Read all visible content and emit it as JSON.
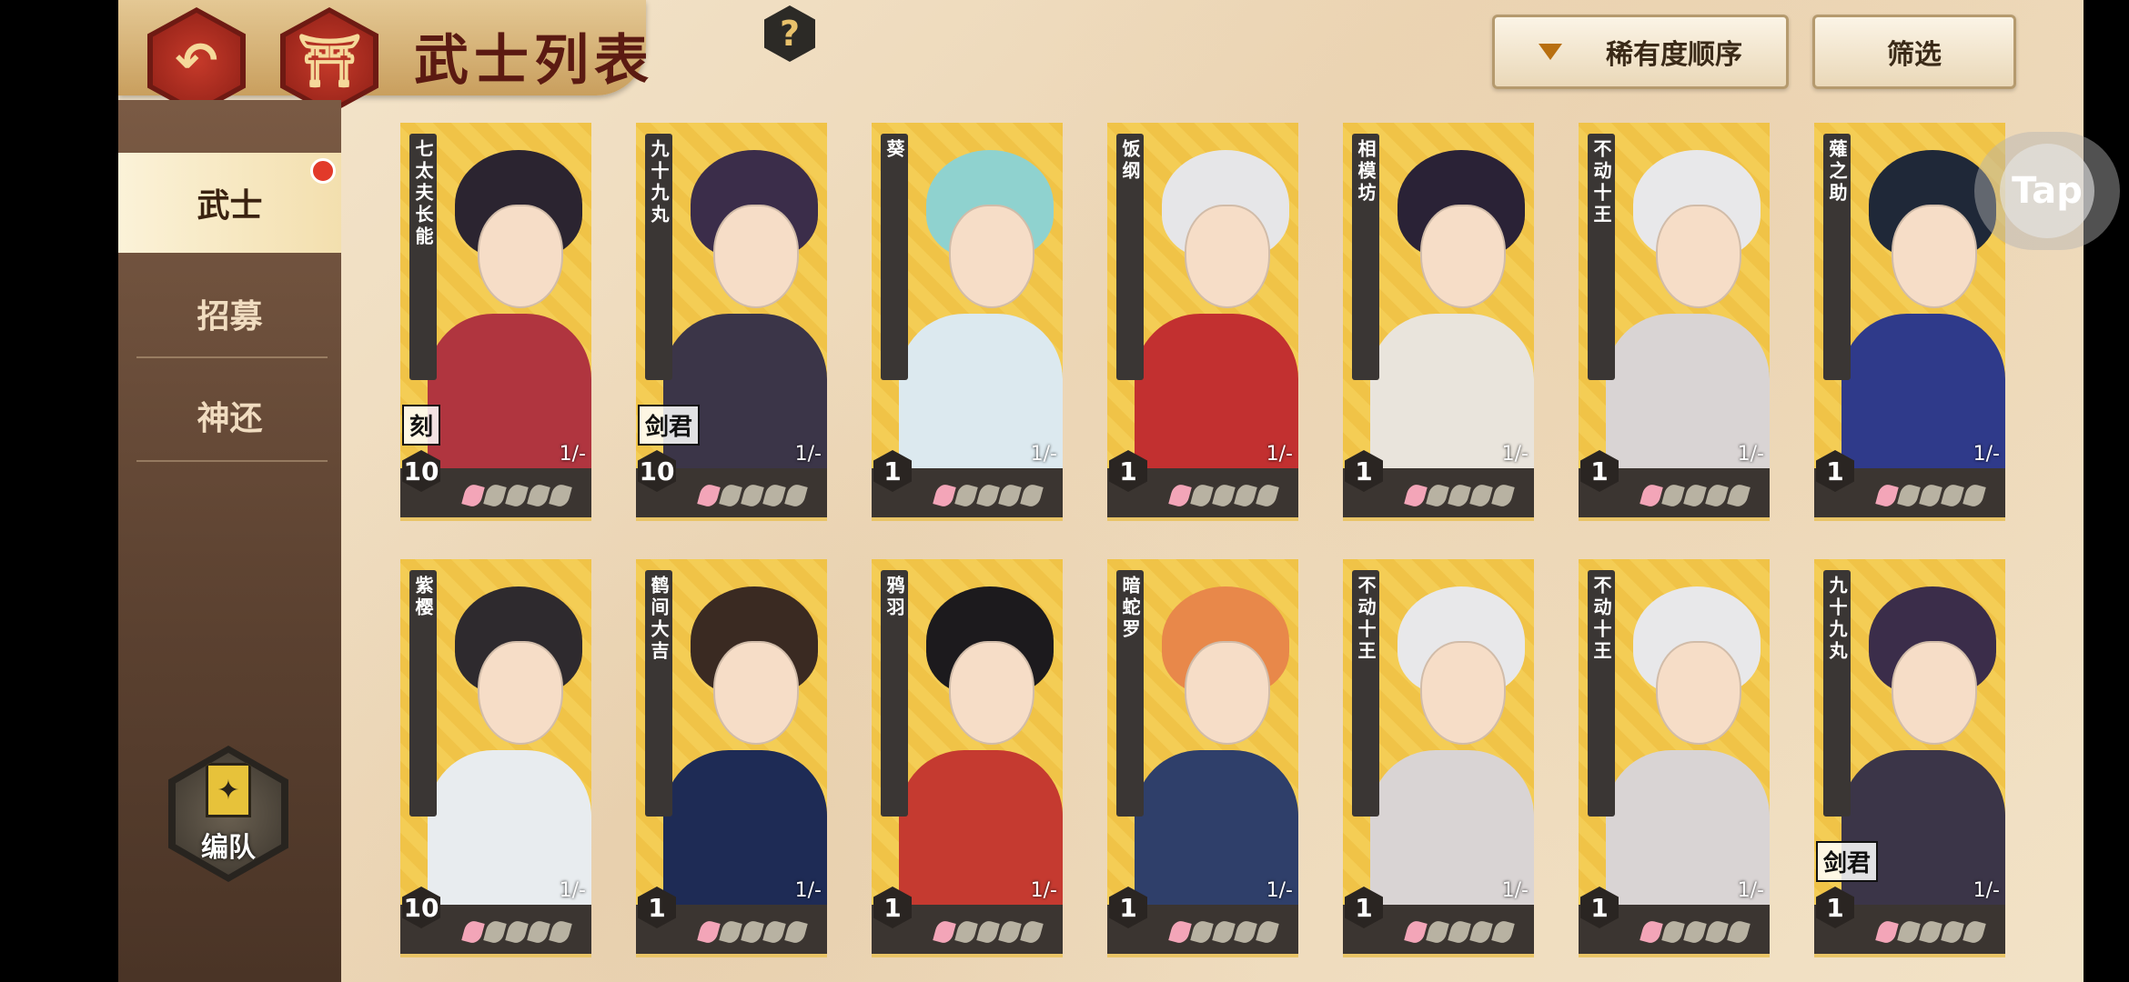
{
  "header": {
    "title": "武士列表",
    "help_label": "?",
    "sort_label": "稀有度顺序",
    "filter_label": "筛选",
    "back_glyph": "↶",
    "home_glyph": "⛩"
  },
  "sidebar": {
    "items": [
      {
        "label": "武士",
        "active": true,
        "badge": true
      },
      {
        "label": "招募",
        "active": false
      },
      {
        "label": "神还",
        "active": false
      }
    ],
    "team_label": "编队"
  },
  "overlay": {
    "tap_label": "Tap"
  },
  "cards": [
    {
      "name": "七太夫长能",
      "level": "10",
      "count": "1/-",
      "seal": "刻",
      "petals_pink": 1,
      "hair": "#2b2430",
      "outfit": "#b0353f"
    },
    {
      "name": "九十九丸",
      "level": "10",
      "count": "1/-",
      "seal": "剑君",
      "petals_pink": 1,
      "hair": "#3b2d4a",
      "outfit": "#3b3548"
    },
    {
      "name": "葵",
      "level": "1",
      "count": "1/-",
      "seal": "",
      "petals_pink": 1,
      "hair": "#8fd2cf",
      "outfit": "#dce9ef"
    },
    {
      "name": "饭纲",
      "level": "1",
      "count": "1/-",
      "seal": "",
      "petals_pink": 1,
      "hair": "#e6e6e8",
      "outfit": "#c23030"
    },
    {
      "name": "相模坊",
      "level": "1",
      "count": "1/-",
      "seal": "",
      "petals_pink": 1,
      "hair": "#2a2236",
      "outfit": "#e9e4dc"
    },
    {
      "name": "不动十王",
      "level": "1",
      "count": "1/-",
      "seal": "",
      "petals_pink": 1,
      "hair": "#e8e8ea",
      "outfit": "#d9d4d4"
    },
    {
      "name": "薙之助",
      "level": "1",
      "count": "1/-",
      "seal": "",
      "petals_pink": 1,
      "hair": "#1f2838",
      "outfit": "#2f3a8a"
    },
    {
      "name": "紫樱",
      "level": "10",
      "count": "1/-",
      "seal": "",
      "petals_pink": 1,
      "hair": "#2e2a2e",
      "outfit": "#e8ecef"
    },
    {
      "name": "鹤间大吉",
      "level": "1",
      "count": "1/-",
      "seal": "",
      "petals_pink": 1,
      "hair": "#3a2a22",
      "outfit": "#1e2b55"
    },
    {
      "name": "鸦羽",
      "level": "1",
      "count": "1/-",
      "seal": "",
      "petals_pink": 1,
      "hair": "#1c1a1d",
      "outfit": "#c53a30"
    },
    {
      "name": "暗蛇罗",
      "level": "1",
      "count": "1/-",
      "seal": "",
      "petals_pink": 1,
      "hair": "#e8884a",
      "outfit": "#2f3f6a"
    },
    {
      "name": "不动十王",
      "level": "1",
      "count": "1/-",
      "seal": "",
      "petals_pink": 1,
      "hair": "#e8e8ea",
      "outfit": "#d9d4d4"
    },
    {
      "name": "不动十王",
      "level": "1",
      "count": "1/-",
      "seal": "",
      "petals_pink": 1,
      "hair": "#e8e8ea",
      "outfit": "#d9d4d4"
    },
    {
      "name": "九十九丸",
      "level": "1",
      "count": "1/-",
      "seal": "剑君",
      "petals_pink": 1,
      "hair": "#3b2d4a",
      "outfit": "#3b3548"
    }
  ]
}
